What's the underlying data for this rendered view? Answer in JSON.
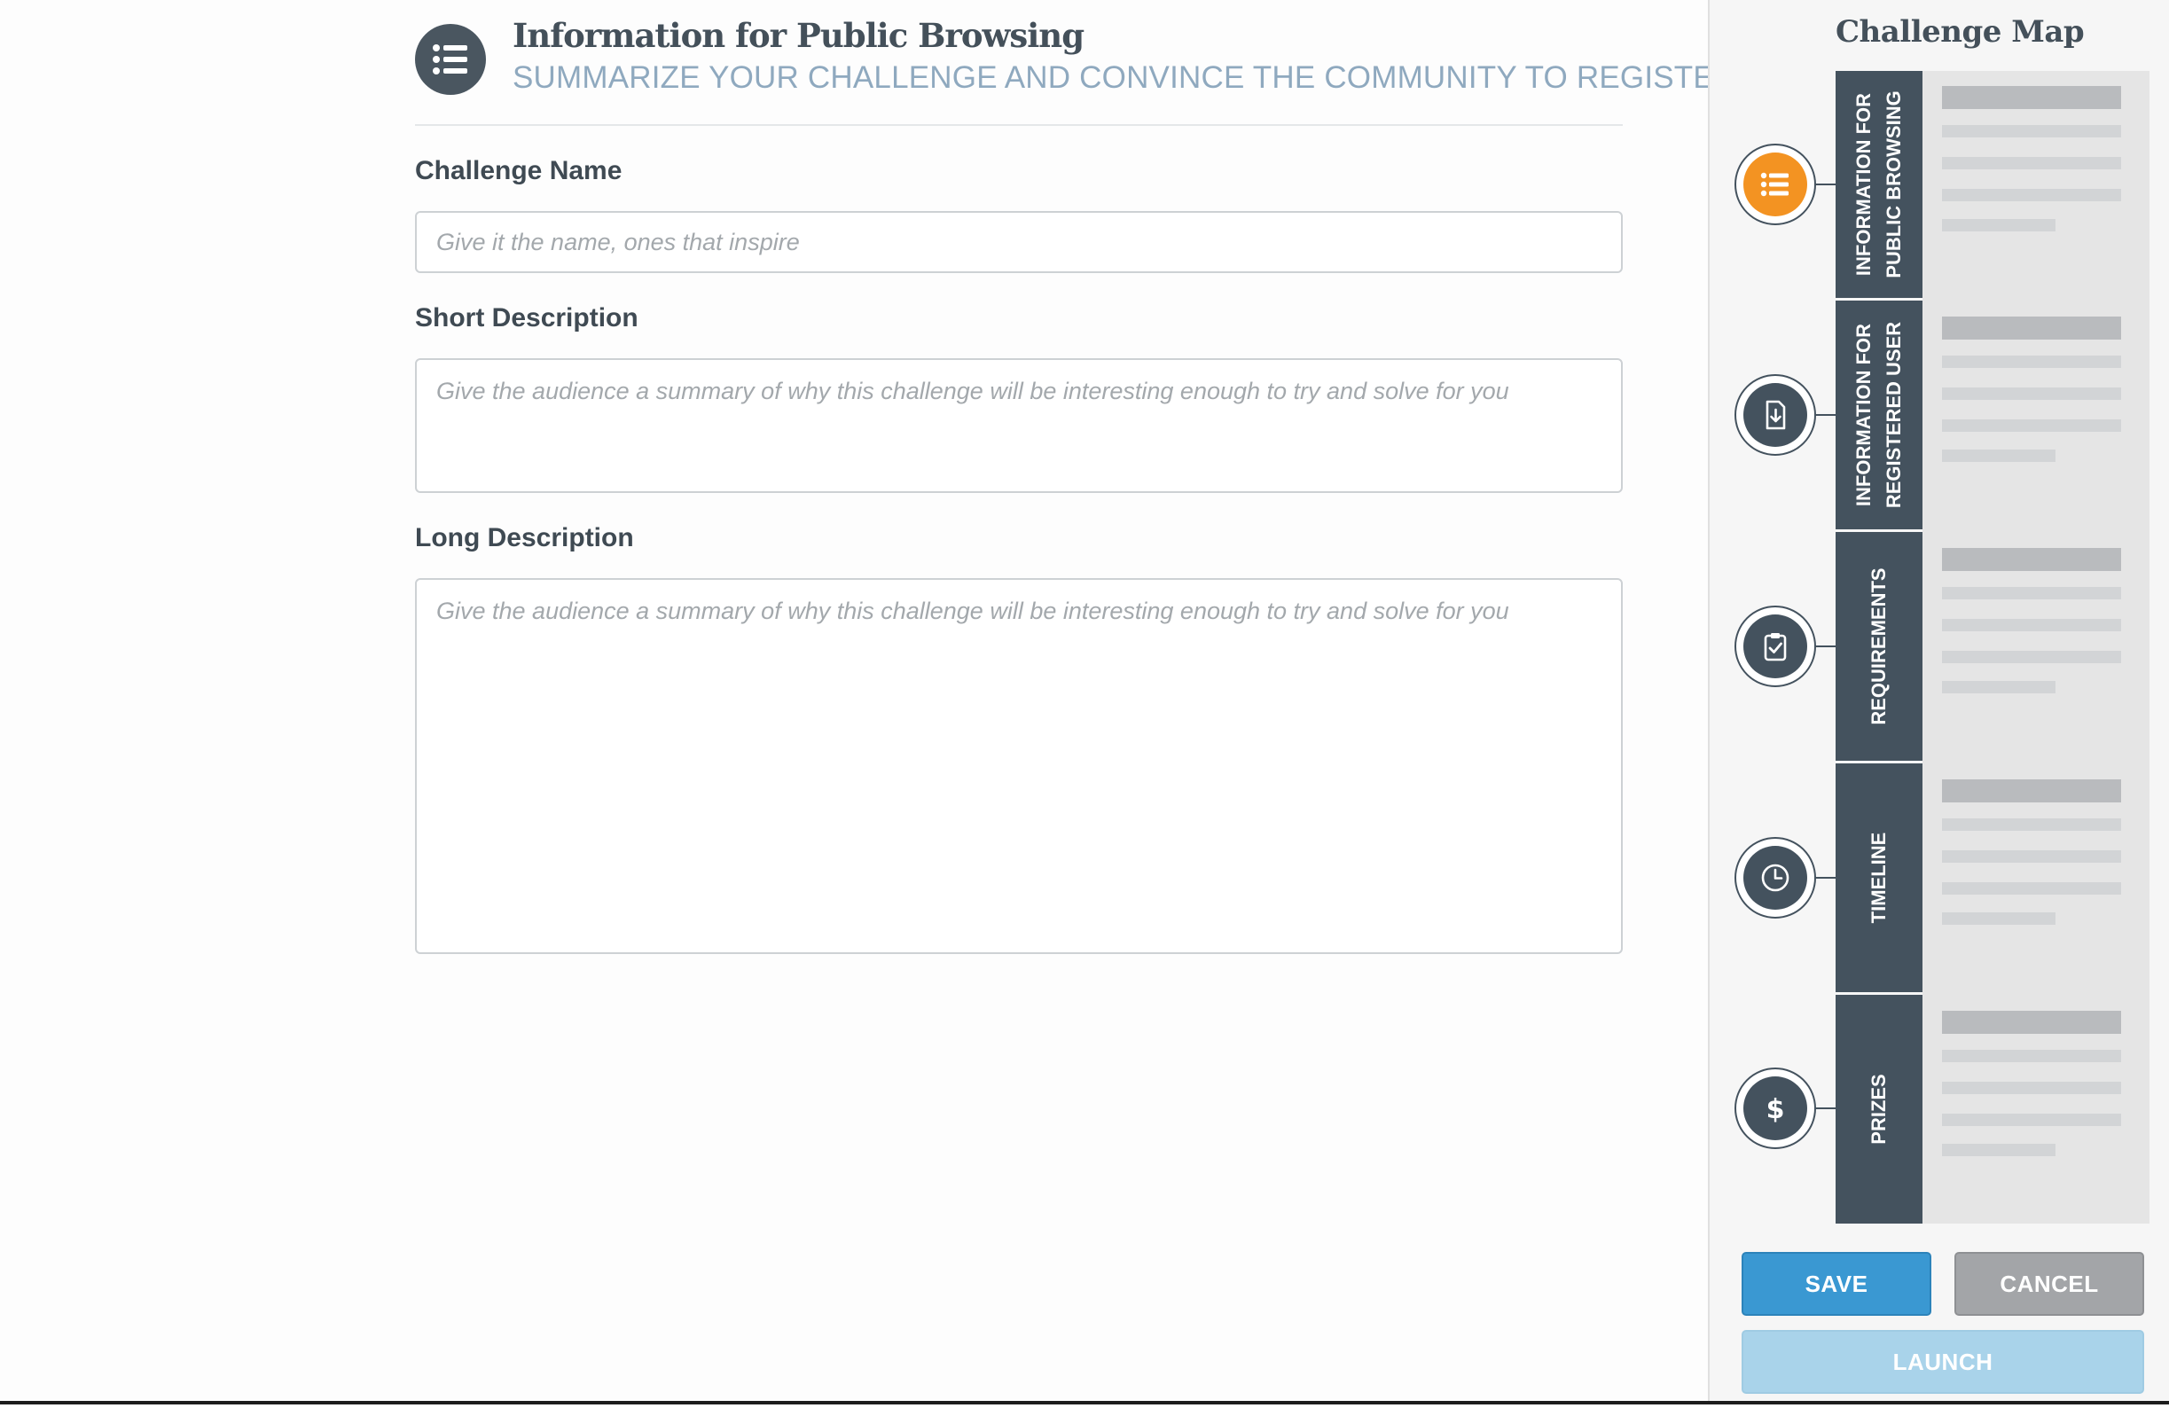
{
  "header": {
    "icon": "list-icon",
    "title": "Information for Public Browsing",
    "subtitle": "SUMMARIZE YOUR CHALLENGE AND CONVINCE THE COMMUNITY TO REGISTER"
  },
  "form": {
    "challenge_name": {
      "label": "Challenge Name",
      "value": "",
      "placeholder": "Give it the name, ones that inspire"
    },
    "short_description": {
      "label": "Short Description",
      "value": "",
      "placeholder": "Give the audience a summary of why this challenge will be interesting enough to try and solve for you"
    },
    "long_description": {
      "label": "Long Description",
      "value": "",
      "placeholder": "Give the audience a summary of why this challenge will be interesting enough to try and solve for you"
    }
  },
  "sidebar": {
    "title": "Challenge Map",
    "steps": [
      {
        "label": "INFORMATION FOR\nPUBLIC BROWSING",
        "icon": "list-icon",
        "active": true
      },
      {
        "label": "INFORMATION FOR\nREGISTERED USER",
        "icon": "document-download-icon",
        "active": false
      },
      {
        "label": "REQUIREMENTS",
        "icon": "clipboard-check-icon",
        "active": false
      },
      {
        "label": "TIMELINE",
        "icon": "clock-icon",
        "active": false
      },
      {
        "label": "PRIZES",
        "icon": "dollar-icon",
        "active": false
      }
    ]
  },
  "buttons": {
    "save": "SAVE",
    "cancel": "CANCEL",
    "launch": "LAUNCH"
  },
  "colors": {
    "accent_orange": "#f39322",
    "dark_slate": "#44525e",
    "save_blue": "#3a98d2",
    "launch_blue_disabled": "#a9d3ea",
    "cancel_gray": "#a3a5a8",
    "subtitle_blue": "#8fa9bf"
  }
}
